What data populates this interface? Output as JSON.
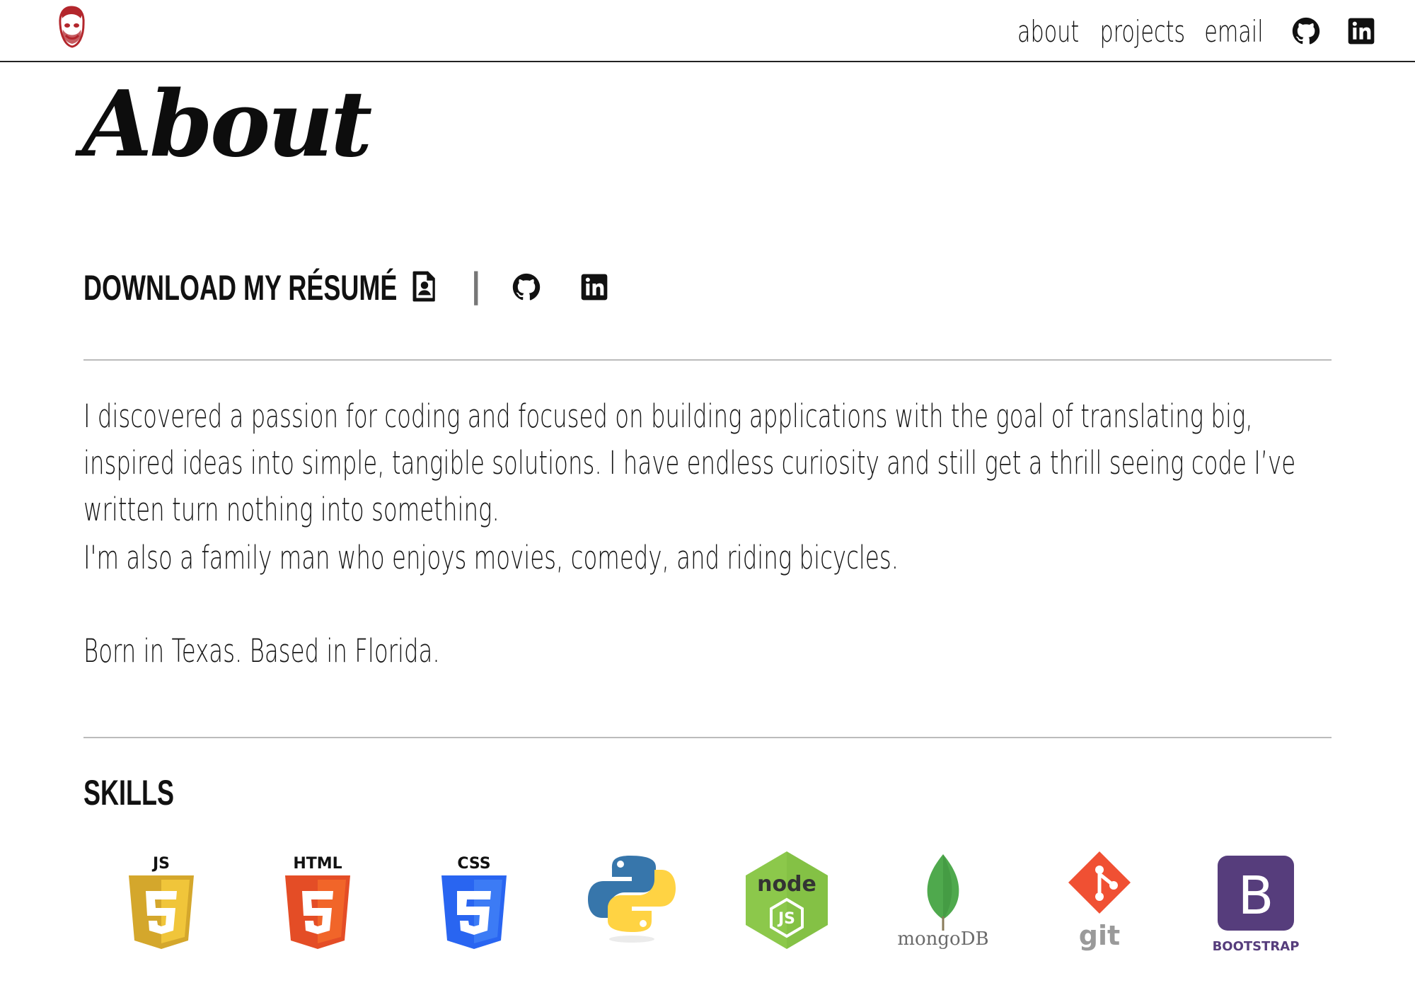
{
  "nav": {
    "links": [
      "about",
      "projects",
      "email"
    ],
    "icons": [
      "github-icon",
      "linkedin-icon"
    ]
  },
  "page_title": "About",
  "resume": {
    "label": "DOWNLOAD MY RÉSUMÉ",
    "separator": "|"
  },
  "bio": [
    "I discovered a passion for coding and focused on building applications with the goal of translating big, inspired ideas into simple, tangible solutions. I have endless curiosity and still get a thrill seeing code I’ve written turn nothing into something.",
    "I'm also a family man who enjoys movies, comedy, and riding bicycles.",
    "Born in Texas. Based in Florida."
  ],
  "skills": {
    "title": "SKILLS",
    "badges": {
      "js": "JS",
      "html": "HTML",
      "css": "CSS",
      "node": "node",
      "node_sub": "JS",
      "mongo": "mongoDB",
      "git": "git",
      "bootstrap": "BOOTSTRAP",
      "bootstrap_letter": "B"
    }
  },
  "colors": {
    "js_shield": "#d4a72c",
    "html_shield": "#e44d26",
    "css_shield": "#2965f1",
    "python_blue": "#3776ab",
    "python_yellow": "#ffd343",
    "node_green": "#8cc84b",
    "mongo_green": "#4fa94d",
    "git_orange": "#f05033",
    "bootstrap_purple": "#563d7c"
  }
}
